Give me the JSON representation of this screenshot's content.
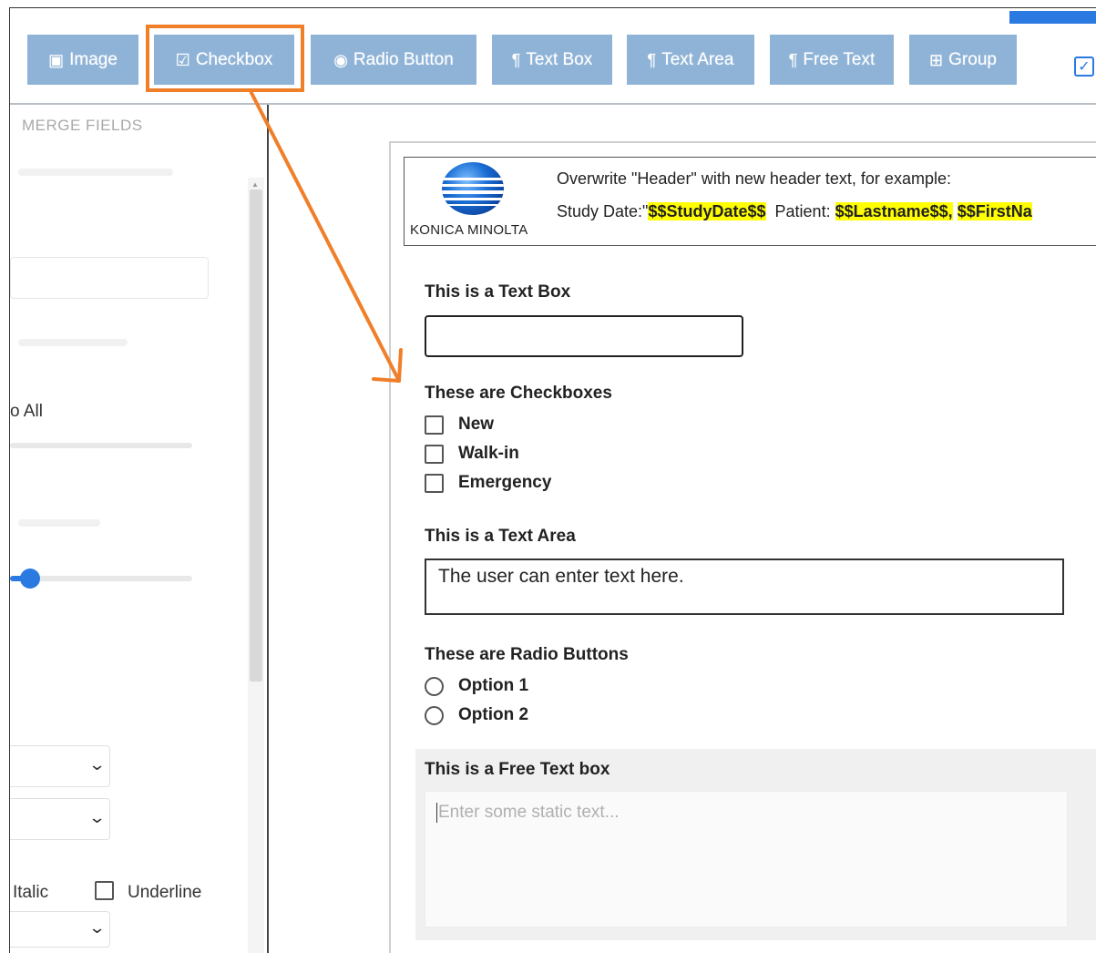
{
  "toolbar": {
    "buttons": [
      {
        "icon": "▣",
        "label": "Image"
      },
      {
        "icon": "☑",
        "label": "Checkbox"
      },
      {
        "icon": "◉",
        "label": "Radio Button"
      },
      {
        "icon": "¶",
        "label": "Text Box"
      },
      {
        "icon": "¶",
        "label": "Text Area"
      },
      {
        "icon": "¶",
        "label": "Free Text"
      },
      {
        "icon": "⊞",
        "label": "Group"
      }
    ],
    "top_checkbox_glyph": "✓"
  },
  "left_panel": {
    "section_title": "MERGE FIELDS",
    "apply_all_label": "o All",
    "italic_label": "Italic",
    "underline_label": "Underline",
    "slider_value": 0.05
  },
  "form": {
    "header": {
      "logo_text": "KONICA MINOLTA",
      "line1": "Overwrite \"Header\" with new header text, for example:",
      "line2_prefix": "Study Date:\"",
      "study_date_field": "$$StudyDate$$",
      "patient_label": "Patient:",
      "lastname_field": "$$Lastname$$,",
      "firstname_field": "$$FirstNa"
    },
    "text_box_label": "This is a Text Box",
    "checkboxes_label": "These are Checkboxes",
    "checkboxes": [
      "New",
      "Walk-in",
      "Emergency"
    ],
    "text_area_label": "This is a Text Area",
    "text_area_value": "The user can enter text here.",
    "radio_label": "These are Radio Buttons",
    "radios": [
      "Option 1",
      "Option 2"
    ],
    "free_text_label": "This is a Free Text box",
    "free_text_placeholder": "Enter some static text..."
  },
  "colors": {
    "toolbar_button": "#8fb3d7",
    "highlight": "#f07f2a",
    "accent": "#2a7ae2",
    "merge_highlight": "#ffff00"
  }
}
